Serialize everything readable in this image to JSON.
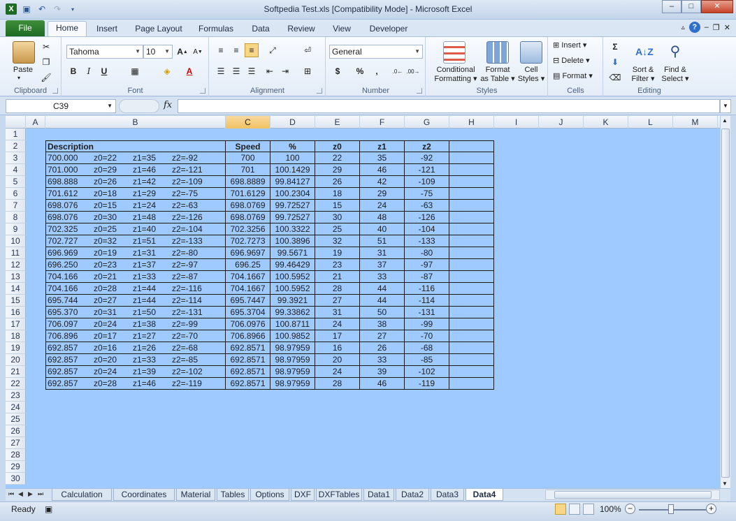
{
  "window": {
    "title": "Softpedia Test.xls  [Compatibility Mode]  -  Microsoft Excel",
    "minimize": "–",
    "maximize": "□",
    "close": "✕"
  },
  "ribbon_tabs": [
    "File",
    "Home",
    "Insert",
    "Page Layout",
    "Formulas",
    "Data",
    "Review",
    "View",
    "Developer"
  ],
  "ribbon": {
    "clipboard": {
      "label": "Clipboard",
      "paste": "Paste"
    },
    "font": {
      "label": "Font",
      "font_name": "Tahoma",
      "font_size": "10"
    },
    "alignment": {
      "label": "Alignment"
    },
    "number": {
      "label": "Number",
      "format": "General"
    },
    "styles": {
      "label": "Styles",
      "conditional_1": "Conditional",
      "conditional_2": "Formatting",
      "format_table_1": "Format",
      "format_table_2": "as Table",
      "cell_styles_1": "Cell",
      "cell_styles_2": "Styles"
    },
    "cells": {
      "label": "Cells",
      "insert": "Insert",
      "delete": "Delete",
      "format": "Format"
    },
    "editing": {
      "label": "Editing",
      "sort_1": "Sort &",
      "sort_2": "Filter",
      "find_1": "Find &",
      "find_2": "Select"
    }
  },
  "formula_bar": {
    "name_box": "C39",
    "fx": "fx",
    "value": ""
  },
  "columns": [
    "A",
    "B",
    "C",
    "D",
    "E",
    "F",
    "G",
    "H",
    "I",
    "J",
    "K",
    "L",
    "M"
  ],
  "selected_column": "C",
  "rows": [
    "1",
    "2",
    "3",
    "4",
    "5",
    "6",
    "7",
    "8",
    "9",
    "10",
    "11",
    "12",
    "13",
    "14",
    "15",
    "16",
    "17",
    "18",
    "19",
    "20",
    "21",
    "22",
    "23",
    "24",
    "25",
    "26",
    "27",
    "28",
    "29",
    "30"
  ],
  "table": {
    "headers": [
      "Description",
      "Speed",
      "%",
      "z0",
      "z1",
      "z2"
    ],
    "rows": [
      [
        [
          "700.000",
          "z0=22",
          "z1=35",
          "z2=-92"
        ],
        "700",
        "100",
        "22",
        "35",
        "-92"
      ],
      [
        [
          "701.000",
          "z0=29",
          "z1=46",
          "z2=-121"
        ],
        "701",
        "100.1429",
        "29",
        "46",
        "-121"
      ],
      [
        [
          "698.888",
          "z0=26",
          "z1=42",
          "z2=-109"
        ],
        "698.8889",
        "99.84127",
        "26",
        "42",
        "-109"
      ],
      [
        [
          "701.612",
          "z0=18",
          "z1=29",
          "z2=-75"
        ],
        "701.6129",
        "100.2304",
        "18",
        "29",
        "-75"
      ],
      [
        [
          "698.076",
          "z0=15",
          "z1=24",
          "z2=-63"
        ],
        "698.0769",
        "99.72527",
        "15",
        "24",
        "-63"
      ],
      [
        [
          "698.076",
          "z0=30",
          "z1=48",
          "z2=-126"
        ],
        "698.0769",
        "99.72527",
        "30",
        "48",
        "-126"
      ],
      [
        [
          "702.325",
          "z0=25",
          "z1=40",
          "z2=-104"
        ],
        "702.3256",
        "100.3322",
        "25",
        "40",
        "-104"
      ],
      [
        [
          "702.727",
          "z0=32",
          "z1=51",
          "z2=-133"
        ],
        "702.7273",
        "100.3896",
        "32",
        "51",
        "-133"
      ],
      [
        [
          "696.969",
          "z0=19",
          "z1=31",
          "z2=-80"
        ],
        "696.9697",
        "99.5671",
        "19",
        "31",
        "-80"
      ],
      [
        [
          "696.250",
          "z0=23",
          "z1=37",
          "z2=-97"
        ],
        "696.25",
        "99.46429",
        "23",
        "37",
        "-97"
      ],
      [
        [
          "704.166",
          "z0=21",
          "z1=33",
          "z2=-87"
        ],
        "704.1667",
        "100.5952",
        "21",
        "33",
        "-87"
      ],
      [
        [
          "704.166",
          "z0=28",
          "z1=44",
          "z2=-116"
        ],
        "704.1667",
        "100.5952",
        "28",
        "44",
        "-116"
      ],
      [
        [
          "695.744",
          "z0=27",
          "z1=44",
          "z2=-114"
        ],
        "695.7447",
        "99.3921",
        "27",
        "44",
        "-114"
      ],
      [
        [
          "695.370",
          "z0=31",
          "z1=50",
          "z2=-131"
        ],
        "695.3704",
        "99.33862",
        "31",
        "50",
        "-131"
      ],
      [
        [
          "706.097",
          "z0=24",
          "z1=38",
          "z2=-99"
        ],
        "706.0976",
        "100.8711",
        "24",
        "38",
        "-99"
      ],
      [
        [
          "706.896",
          "z0=17",
          "z1=27",
          "z2=-70"
        ],
        "706.8966",
        "100.9852",
        "17",
        "27",
        "-70"
      ],
      [
        [
          "692.857",
          "z0=16",
          "z1=26",
          "z2=-68"
        ],
        "692.8571",
        "98.97959",
        "16",
        "26",
        "-68"
      ],
      [
        [
          "692.857",
          "z0=20",
          "z1=33",
          "z2=-85"
        ],
        "692.8571",
        "98.97959",
        "20",
        "33",
        "-85"
      ],
      [
        [
          "692.857",
          "z0=24",
          "z1=39",
          "z2=-102"
        ],
        "692.8571",
        "98.97959",
        "24",
        "39",
        "-102"
      ],
      [
        [
          "692.857",
          "z0=28",
          "z1=46",
          "z2=-119"
        ],
        "692.8571",
        "98.97959",
        "28",
        "46",
        "-119"
      ]
    ]
  },
  "sheet_tabs": [
    "Calculation",
    "Coordinates",
    "Material",
    "Tables",
    "Options",
    "DXF",
    "DXFTables",
    "Data1",
    "Data2",
    "Data3",
    "Data4"
  ],
  "active_sheet": "Data4",
  "status": {
    "ready": "Ready",
    "zoom": "100%",
    "zoom_out": "−",
    "zoom_in": "+"
  },
  "colors": {
    "grid_bg": "#9fcaff",
    "selected_header": "#f1c15f",
    "file_tab": "#1f6b24"
  }
}
